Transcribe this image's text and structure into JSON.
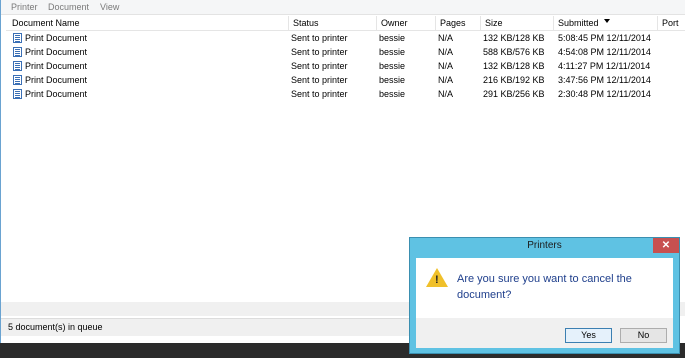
{
  "menu": {
    "items": [
      "Printer",
      "Document",
      "View"
    ]
  },
  "columns": {
    "document_name": "Document Name",
    "status": "Status",
    "owner": "Owner",
    "pages": "Pages",
    "size": "Size",
    "submitted": "Submitted",
    "port": "Port"
  },
  "rows": [
    {
      "name": "Print Document",
      "status": "Sent to printer",
      "owner": "bessie",
      "pages": "N/A",
      "size": "132 KB/128 KB",
      "submitted": "5:08:45 PM  12/11/2014"
    },
    {
      "name": "Print Document",
      "status": "Sent to printer",
      "owner": "bessie",
      "pages": "N/A",
      "size": "588 KB/576 KB",
      "submitted": "4:54:08 PM  12/11/2014"
    },
    {
      "name": "Print Document",
      "status": "Sent to printer",
      "owner": "bessie",
      "pages": "N/A",
      "size": "132 KB/128 KB",
      "submitted": "4:11:27 PM  12/11/2014"
    },
    {
      "name": "Print Document",
      "status": "Sent to printer",
      "owner": "bessie",
      "pages": "N/A",
      "size": "216 KB/192 KB",
      "submitted": "3:47:56 PM  12/11/2014"
    },
    {
      "name": "Print Document",
      "status": "Sent to printer",
      "owner": "bessie",
      "pages": "N/A",
      "size": "291 KB/256 KB",
      "submitted": "2:30:48 PM  12/11/2014"
    }
  ],
  "status_bar": {
    "text": "5 document(s) in queue"
  },
  "dialog": {
    "title": "Printers",
    "close": "✕",
    "message": "Are you sure you want to cancel the document?",
    "yes_label": "Yes",
    "no_label": "No"
  },
  "colors": {
    "dialog_frame": "#5fc2e3",
    "close_button": "#c75050",
    "message_text": "#1f3f8c"
  }
}
